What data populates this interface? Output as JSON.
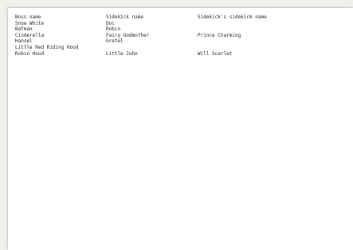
{
  "table": {
    "header": [
      "Boss name",
      "Sidekick name",
      "Sidekick's sidekick name"
    ],
    "rows": [
      [
        "Snow White",
        "Doc",
        ""
      ],
      [
        "Batman",
        "Robin",
        ""
      ],
      [
        "Cinderella",
        "Fairy Godmother",
        "Prince Charming"
      ],
      [
        "Hansel",
        "Gretel",
        ""
      ],
      [
        "Little Red Riding Hood",
        "",
        ""
      ],
      [
        "Robin Hood",
        "Little John",
        "Will Scarlet"
      ]
    ]
  }
}
